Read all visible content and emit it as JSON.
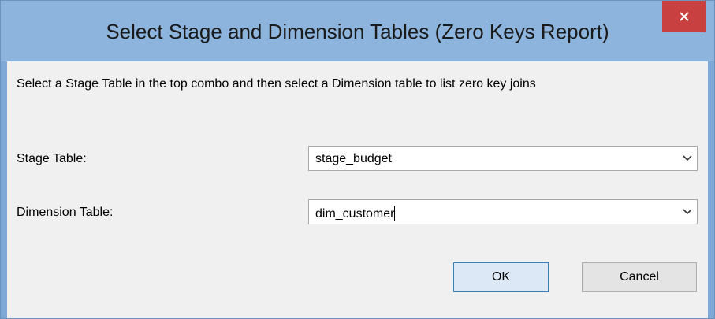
{
  "window": {
    "title": "Select Stage and Dimension Tables (Zero Keys Report)",
    "close_icon": "close-icon",
    "close_color": "#c84040"
  },
  "instructions": "Select a Stage Table in the top combo and then select a Dimension table to list zero key joins",
  "stage": {
    "label": "Stage Table:",
    "value": "stage_budget"
  },
  "dimension": {
    "label": "Dimension Table:",
    "value": "dim_customer"
  },
  "buttons": {
    "ok_label": "OK",
    "cancel_label": "Cancel"
  }
}
